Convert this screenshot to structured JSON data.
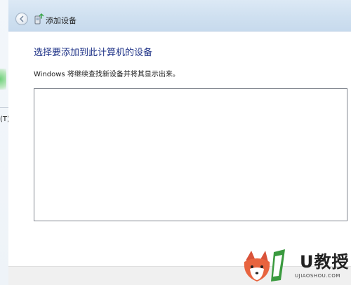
{
  "background_window": {
    "label": "(T)"
  },
  "dialog": {
    "title": "添加设备",
    "heading": "选择要添加到此计算机的设备",
    "description": "Windows 将继续查找新设备并将其显示出来。",
    "device_list": []
  },
  "watermark": {
    "brand": "U教授",
    "url": "UJIAOSHOU.COM"
  },
  "colors": {
    "heading": "#1e3287",
    "titlebar": "#cfe0f0",
    "list_border": "#828790",
    "footer": "#f0f0f0"
  },
  "icons": {
    "back": "back-arrow-icon",
    "device": "add-device-icon",
    "logo": "fox-logo-icon"
  }
}
